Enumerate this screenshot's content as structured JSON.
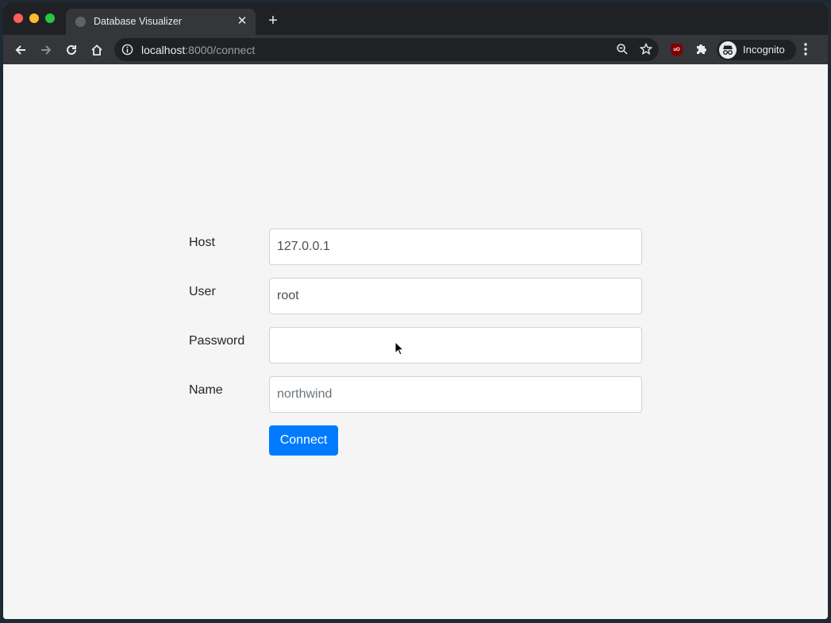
{
  "browser": {
    "tab": {
      "title": "Database Visualizer",
      "favicon": "globe-icon",
      "close_icon": "close-icon"
    },
    "new_tab_icon": "plus-icon",
    "nav": {
      "back_icon": "arrow-left-icon",
      "forward_icon": "arrow-right-icon",
      "reload_icon": "reload-icon",
      "home_icon": "home-icon"
    },
    "address_bar": {
      "info_icon": "info-icon",
      "url_host": "localhost",
      "url_rest": ":8000/connect",
      "zoom_icon": "zoom-out-icon",
      "bookmark_icon": "star-icon"
    },
    "extensions": {
      "ublock_label": "uO",
      "puzzle_icon": "puzzle-icon"
    },
    "profile": {
      "label": "Incognito",
      "icon": "incognito-icon"
    },
    "menu_icon": "kebab-menu-icon"
  },
  "form": {
    "host": {
      "label": "Host",
      "value": "127.0.0.1"
    },
    "user": {
      "label": "User",
      "value": "root"
    },
    "password": {
      "label": "Password",
      "value": ""
    },
    "name": {
      "label": "Name",
      "value": "",
      "placeholder": "northwind"
    },
    "submit_label": "Connect"
  },
  "colors": {
    "primary": "#007bff",
    "page_background": "#f4f5f4",
    "browser_chrome": "#35363a",
    "tabstrip": "#202124"
  }
}
